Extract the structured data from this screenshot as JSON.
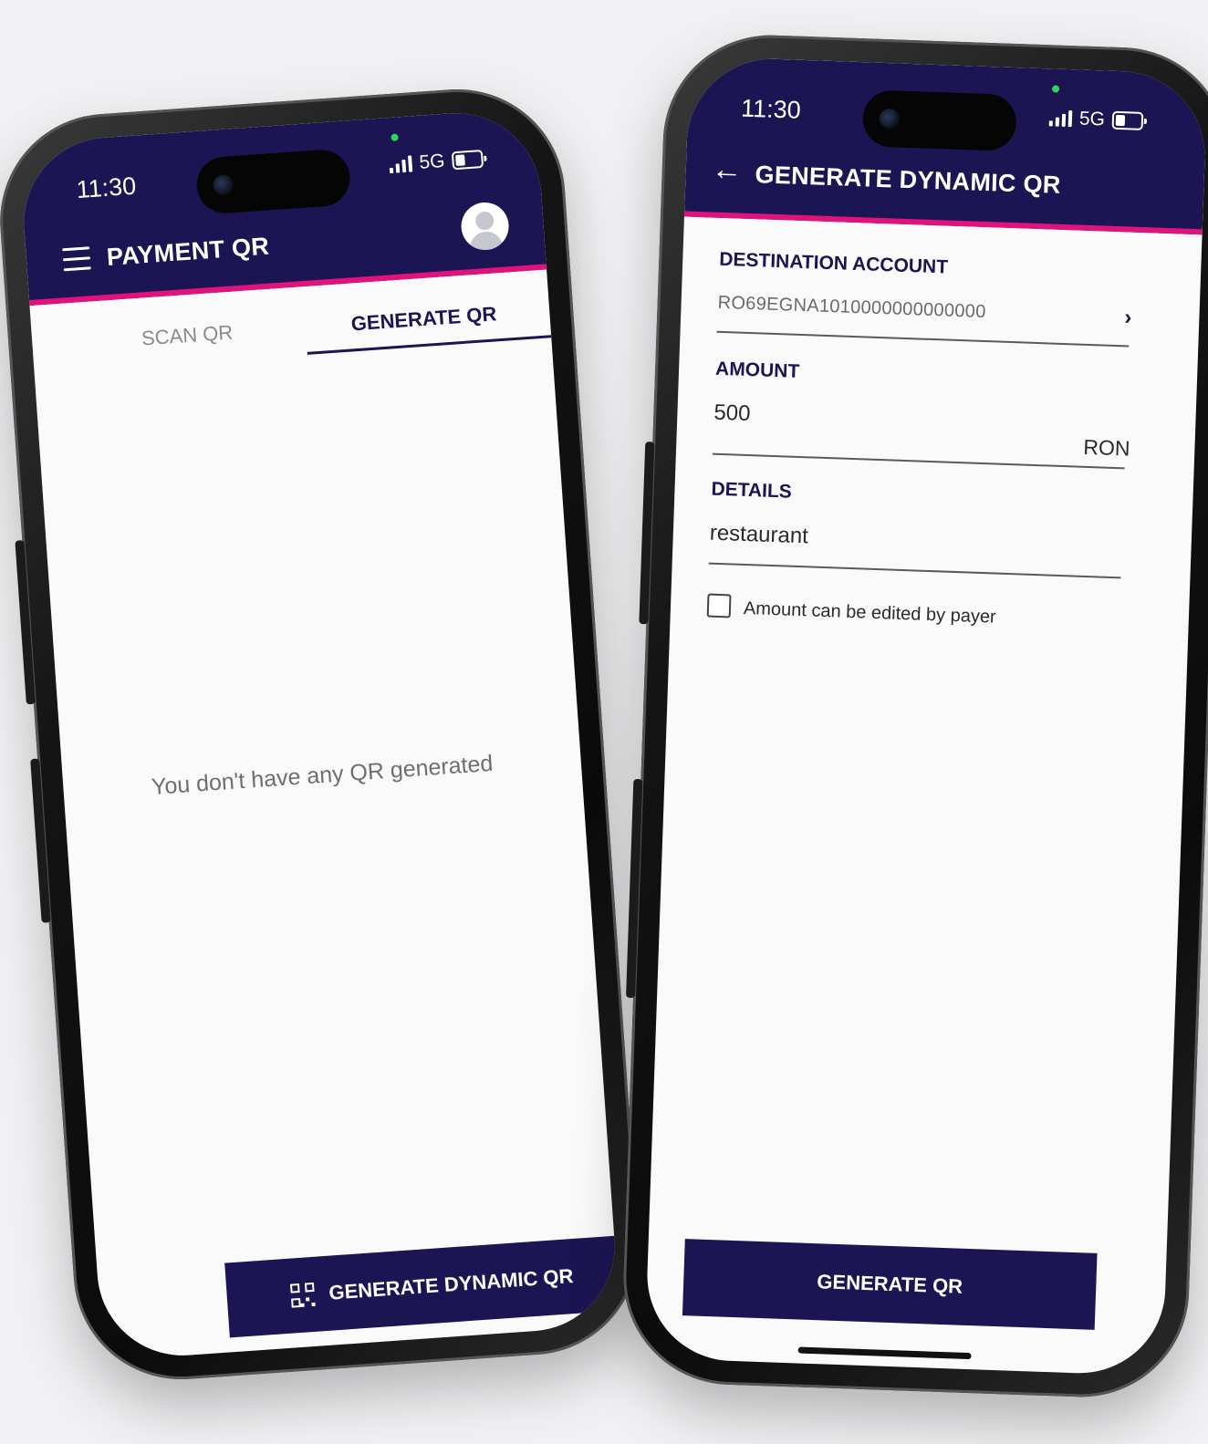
{
  "left_phone": {
    "status": {
      "time": "11:30",
      "network": "5G"
    },
    "header": {
      "title": "PAYMENT QR"
    },
    "tabs": [
      {
        "label": "SCAN QR"
      },
      {
        "label": "GENERATE QR"
      }
    ],
    "empty_message": "You don't have any QR generated",
    "primary_button": {
      "label": "GENERATE DYNAMIC QR"
    }
  },
  "right_phone": {
    "status": {
      "time": "11:30",
      "network": "5G"
    },
    "header": {
      "title": "GENERATE DYNAMIC QR"
    },
    "destination": {
      "label": "DESTINATION ACCOUNT",
      "value": "RO69EGNA1010000000000000"
    },
    "amount": {
      "label": "AMOUNT",
      "value": "500",
      "currency": "RON"
    },
    "details": {
      "label": "DETAILS",
      "value": "restaurant"
    },
    "editable_checkbox": {
      "label": "Amount can be edited by payer",
      "checked": false
    },
    "primary_button": {
      "label": "GENERATE QR"
    }
  },
  "colors": {
    "brand": "#1c1553",
    "accent": "#e0137d",
    "background": "#f1f1f3"
  },
  "icons": [
    "menu-icon",
    "avatar-icon",
    "qr-code-icon",
    "back-arrow-icon",
    "chevron-right-icon",
    "signal-icon",
    "battery-icon"
  ]
}
